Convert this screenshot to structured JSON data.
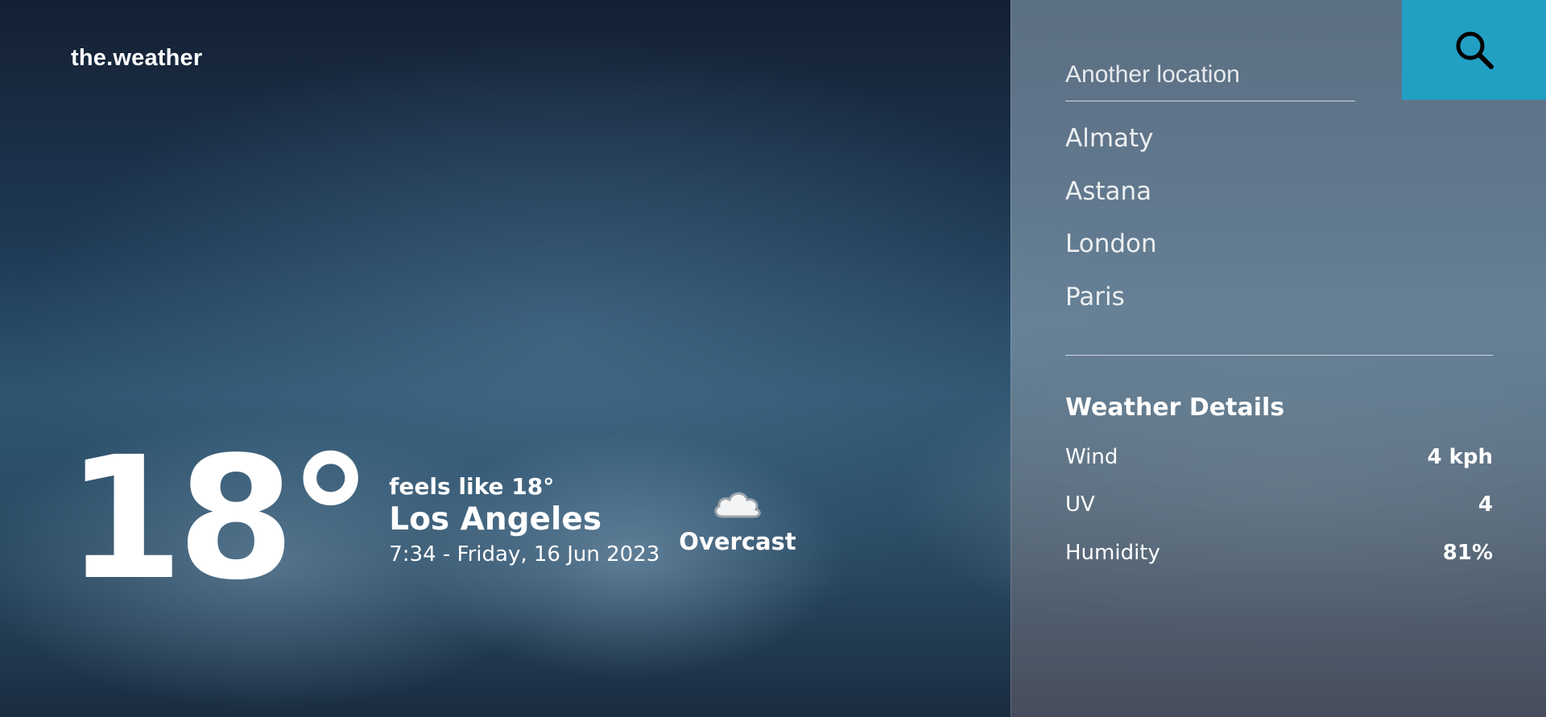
{
  "brand": "the.weather",
  "current": {
    "temperature": "18°",
    "feels_like": "feels like 18°",
    "city": "Los Angeles",
    "datetime": "7:34 - Friday, 16 Jun 2023",
    "condition": "Overcast",
    "condition_icon": "cloud-icon"
  },
  "search": {
    "placeholder": "Another location",
    "icon": "search-icon",
    "accent_color": "#22a0c4"
  },
  "locations": [
    "Almaty",
    "Astana",
    "London",
    "Paris"
  ],
  "details": {
    "title": "Weather Details",
    "rows": [
      {
        "label": "Wind",
        "value": "4 kph"
      },
      {
        "label": "UV",
        "value": "4"
      },
      {
        "label": "Humidity",
        "value": "81%"
      }
    ]
  }
}
